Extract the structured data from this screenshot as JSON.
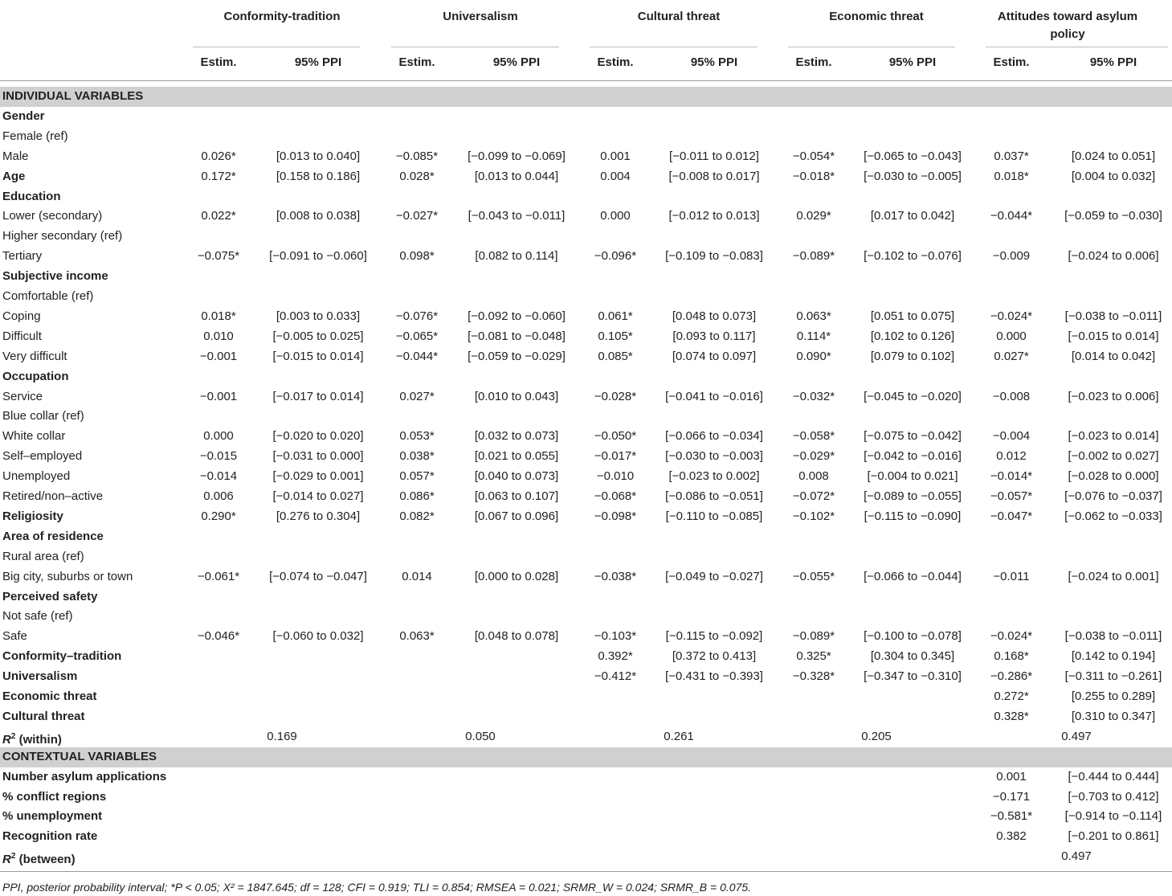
{
  "headers": {
    "groups": [
      "Conformity-tradition",
      "Universalism",
      "Cultural threat",
      "Economic threat",
      "Attitudes toward asylum policy"
    ],
    "estim_label": "Estim.",
    "ppi_label": "95% PPI"
  },
  "rows": [
    {
      "type": "section",
      "label": "INDIVIDUAL VARIABLES"
    },
    {
      "type": "bold",
      "label": "Gender"
    },
    {
      "type": "normal",
      "label": "Female (ref)"
    },
    {
      "type": "normal",
      "label": "Male",
      "cells": [
        "0.026*",
        "[0.013 to 0.040]",
        "−0.085*",
        "[−0.099 to −0.069]",
        "0.001",
        "[−0.011 to 0.012]",
        "−0.054*",
        "[−0.065 to −0.043]",
        "0.037*",
        "[0.024 to 0.051]"
      ]
    },
    {
      "type": "bold",
      "label": "Age",
      "cells": [
        "0.172*",
        "[0.158 to 0.186]",
        "0.028*",
        "[0.013 to 0.044]",
        "0.004",
        "[−0.008 to 0.017]",
        "−0.018*",
        "[−0.030 to −0.005]",
        "0.018*",
        "[0.004 to 0.032]"
      ]
    },
    {
      "type": "bold",
      "label": "Education"
    },
    {
      "type": "normal",
      "label": "Lower (secondary)",
      "cells": [
        "0.022*",
        "[0.008 to 0.038]",
        "−0.027*",
        "[−0.043 to −0.011]",
        "0.000",
        "[−0.012 to 0.013]",
        "0.029*",
        "[0.017 to 0.042]",
        "−0.044*",
        "[−0.059 to −0.030]"
      ]
    },
    {
      "type": "normal",
      "label": "Higher secondary (ref)"
    },
    {
      "type": "normal",
      "label": "Tertiary",
      "cells": [
        "−0.075*",
        "[−0.091 to −0.060]",
        "0.098*",
        "[0.082 to 0.114]",
        "−0.096*",
        "[−0.109 to −0.083]",
        "−0.089*",
        "[−0.102 to −0.076]",
        "−0.009",
        "[−0.024 to 0.006]"
      ]
    },
    {
      "type": "bold",
      "label": "Subjective income"
    },
    {
      "type": "normal",
      "label": "Comfortable (ref)"
    },
    {
      "type": "normal",
      "label": "Coping",
      "cells": [
        "0.018*",
        "[0.003 to 0.033]",
        "−0.076*",
        "[−0.092 to −0.060]",
        "0.061*",
        "[0.048 to 0.073]",
        "0.063*",
        "[0.051 to 0.075]",
        "−0.024*",
        "[−0.038 to −0.011]"
      ]
    },
    {
      "type": "normal",
      "label": "Difficult",
      "cells": [
        "0.010",
        "[−0.005 to 0.025]",
        "−0.065*",
        "[−0.081 to −0.048]",
        "0.105*",
        "[0.093 to 0.117]",
        "0.114*",
        "[0.102 to 0.126]",
        "0.000",
        "[−0.015 to 0.014]"
      ]
    },
    {
      "type": "normal",
      "label": "Very difficult",
      "cells": [
        "−0.001",
        "[−0.015 to 0.014]",
        "−0.044*",
        "[−0.059 to −0.029]",
        "0.085*",
        "[0.074 to 0.097]",
        "0.090*",
        "[0.079 to 0.102]",
        "0.027*",
        "[0.014 to 0.042]"
      ]
    },
    {
      "type": "bold",
      "label": "Occupation"
    },
    {
      "type": "normal",
      "label": "Service",
      "cells": [
        "−0.001",
        "[−0.017 to 0.014]",
        "0.027*",
        "[0.010 to 0.043]",
        "−0.028*",
        "[−0.041 to −0.016]",
        "−0.032*",
        "[−0.045 to −0.020]",
        "−0.008",
        "[−0.023 to 0.006]"
      ]
    },
    {
      "type": "normal",
      "label": "Blue collar (ref)"
    },
    {
      "type": "normal",
      "label": "White collar",
      "cells": [
        "0.000",
        "[−0.020 to 0.020]",
        "0.053*",
        "[0.032 to 0.073]",
        "−0.050*",
        "[−0.066 to −0.034]",
        "−0.058*",
        "[−0.075 to −0.042]",
        "−0.004",
        "[−0.023 to 0.014]"
      ]
    },
    {
      "type": "normal",
      "label": "Self–employed",
      "cells": [
        "−0.015",
        "[−0.031 to 0.000]",
        "0.038*",
        "[0.021 to 0.055]",
        "−0.017*",
        "[−0.030 to −0.003]",
        "−0.029*",
        "[−0.042 to −0.016]",
        "0.012",
        "[−0.002 to 0.027]"
      ]
    },
    {
      "type": "normal",
      "label": "Unemployed",
      "cells": [
        "−0.014",
        "[−0.029 to 0.001]",
        "0.057*",
        "[0.040 to 0.073]",
        "−0.010",
        "[−0.023 to 0.002]",
        "0.008",
        "[−0.004 to 0.021]",
        "−0.014*",
        "[−0.028 to 0.000]"
      ]
    },
    {
      "type": "normal",
      "label": "Retired/non–active",
      "cells": [
        "0.006",
        "[−0.014 to 0.027]",
        "0.086*",
        "[0.063 to 0.107]",
        "−0.068*",
        "[−0.086 to −0.051]",
        "−0.072*",
        "[−0.089 to −0.055]",
        "−0.057*",
        "[−0.076 to −0.037]"
      ]
    },
    {
      "type": "bold",
      "label": "Religiosity",
      "cells": [
        "0.290*",
        "[0.276 to 0.304]",
        "0.082*",
        "[0.067 to 0.096]",
        "−0.098*",
        "[−0.110 to −0.085]",
        "−0.102*",
        "[−0.115 to −0.090]",
        "−0.047*",
        "[−0.062 to −0.033]"
      ]
    },
    {
      "type": "bold",
      "label": "Area of residence"
    },
    {
      "type": "normal",
      "label": "Rural area (ref)"
    },
    {
      "type": "normal",
      "label": "Big city, suburbs or town",
      "cells": [
        "−0.061*",
        "[−0.074 to −0.047]",
        "0.014",
        "[0.000 to 0.028]",
        "−0.038*",
        "[−0.049 to −0.027]",
        "−0.055*",
        "[−0.066 to −0.044]",
        "−0.011",
        "[−0.024 to 0.001]"
      ]
    },
    {
      "type": "bold",
      "label": "Perceived safety"
    },
    {
      "type": "normal",
      "label": "Not safe (ref)"
    },
    {
      "type": "normal",
      "label": "Safe",
      "cells": [
        "−0.046*",
        "[−0.060 to 0.032]",
        "0.063*",
        "[0.048 to 0.078]",
        "−0.103*",
        "[−0.115 to −0.092]",
        "−0.089*",
        "[−0.100 to −0.078]",
        "−0.024*",
        "[−0.038 to −0.011]"
      ]
    },
    {
      "type": "bold",
      "label": "Conformity–tradition",
      "cells": [
        "",
        "",
        "",
        "",
        "0.392*",
        "[0.372 to 0.413]",
        "0.325*",
        "[0.304 to 0.345]",
        "0.168*",
        "[0.142 to 0.194]"
      ]
    },
    {
      "type": "bold",
      "label": "Universalism",
      "cells": [
        "",
        "",
        "",
        "",
        "−0.412*",
        "[−0.431 to −0.393]",
        "−0.328*",
        "[−0.347 to −0.310]",
        "−0.286*",
        "[−0.311 to −0.261]"
      ]
    },
    {
      "type": "bold",
      "label": "Economic threat",
      "cells": [
        "",
        "",
        "",
        "",
        "",
        "",
        "",
        "",
        "0.272*",
        "[0.255 to 0.289]"
      ]
    },
    {
      "type": "bold",
      "label": "Cultural threat",
      "cells": [
        "",
        "",
        "",
        "",
        "",
        "",
        "",
        "",
        "0.328*",
        "[0.310 to 0.347]"
      ]
    },
    {
      "type": "r2",
      "label": "R",
      "sup": "2",
      "suffix": " (within)",
      "r2": [
        "0.169",
        "0.050",
        "0.261",
        "0.205",
        "0.497"
      ]
    },
    {
      "type": "section",
      "label": "CONTEXTUAL VARIABLES"
    },
    {
      "type": "bold",
      "label": "Number asylum applications",
      "cells": [
        "",
        "",
        "",
        "",
        "",
        "",
        "",
        "",
        "0.001",
        "[−0.444 to 0.444]"
      ]
    },
    {
      "type": "bold",
      "label": "% conflict regions",
      "cells": [
        "",
        "",
        "",
        "",
        "",
        "",
        "",
        "",
        "−0.171",
        "[−0.703 to 0.412]"
      ]
    },
    {
      "type": "bold",
      "label": "% unemployment",
      "cells": [
        "",
        "",
        "",
        "",
        "",
        "",
        "",
        "",
        "−0.581*",
        "[−0.914 to −0.114]"
      ]
    },
    {
      "type": "bold",
      "label": "Recognition rate",
      "cells": [
        "",
        "",
        "",
        "",
        "",
        "",
        "",
        "",
        "0.382",
        "[−0.201 to 0.861]"
      ]
    },
    {
      "type": "r2",
      "label": "R",
      "sup": "2",
      "suffix": " (between)",
      "r2": [
        "",
        "",
        "",
        "",
        "0.497"
      ]
    }
  ],
  "footnote": "PPI, posterior probability interval; *P < 0.05; X² = 1847.645; df = 128; CFI = 0.919; TLI = 0.854; RMSEA = 0.021; SRMR_W = 0.024; SRMR_B = 0.075."
}
